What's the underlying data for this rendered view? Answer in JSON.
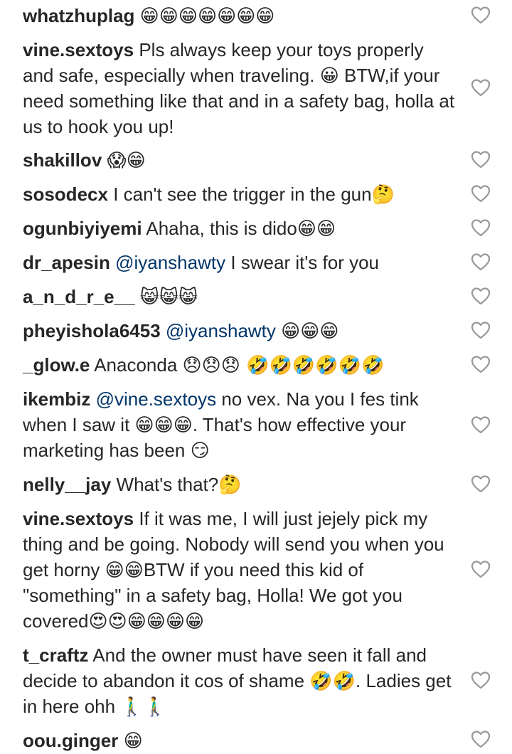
{
  "comments": [
    {
      "username": "whatzhuplag",
      "mention": "",
      "text": "",
      "emoji": "😁😁😁😁😁😁😁"
    },
    {
      "username": "vine.sextoys",
      "mention": "",
      "text": "Pls always keep your toys properly and safe, especially when traveling. 😀 BTW,if your need something like that and in a safety bag, holla at us to hook you up!",
      "emoji": ""
    },
    {
      "username": "shakillov",
      "mention": "",
      "text": "",
      "emoji": "😱😁"
    },
    {
      "username": "sosodecx",
      "mention": "",
      "text": "I can't see the trigger in the gun",
      "emoji": "🤔"
    },
    {
      "username": "ogunbiyiyemi",
      "mention": "",
      "text": "Ahaha, this is dido",
      "emoji": "😁😁"
    },
    {
      "username": "dr_apesin",
      "mention": "@iyanshawty",
      "text": "I swear it's for you",
      "emoji": ""
    },
    {
      "username": "a_n_d_r_e__",
      "mention": "",
      "text": "",
      "emoji": "😸😸😸"
    },
    {
      "username": "pheyishola6453",
      "mention": "@iyanshawty",
      "text": "",
      "emoji": "😁😁😁"
    },
    {
      "username": "_glow.e",
      "mention": "",
      "text": "Anaconda",
      "emoji": "😞😞😞 🤣🤣🤣🤣🤣🤣"
    },
    {
      "username": "ikembiz",
      "mention": "@vine.sextoys",
      "text": "no vex. Na you I fes tink when I saw it 😁😁😁. That's how effective your marketing has been 😏",
      "emoji": ""
    },
    {
      "username": "nelly__jay",
      "mention": "",
      "text": "What's that?",
      "emoji": "🤔"
    },
    {
      "username": "vine.sextoys",
      "mention": "",
      "text": "If it was me, I will just jejely pick my thing and be going. Nobody will send you when you get horny 😁😁BTW if you need this kid of \"something\" in a safety bag, Holla! We got you covered😍😍😁😁😁😁",
      "emoji": ""
    },
    {
      "username": "t_craftz",
      "mention": "",
      "text": "And the owner must have seen it fall and decide to abandon it cos of shame 🤣🤣. Ladies get in here ohh 🚶‍♂🚶‍♂",
      "emoji": ""
    },
    {
      "username": "oou.ginger",
      "mention": "",
      "text": "",
      "emoji": "😁"
    }
  ],
  "icons": {
    "like": "heart-outline-icon"
  },
  "colors": {
    "text": "#262626",
    "mention": "#003569",
    "icon": "#999999"
  }
}
